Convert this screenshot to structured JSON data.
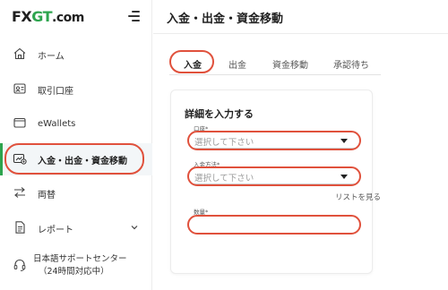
{
  "brand": {
    "logo_fx": "FX",
    "logo_gt": "GT",
    "logo_com": ".com"
  },
  "sidebar": {
    "items": [
      {
        "label": "ホーム",
        "icon": "home-icon"
      },
      {
        "label": "取引口座",
        "icon": "trading-account-icon"
      },
      {
        "label": "eWallets",
        "icon": "wallet-icon"
      },
      {
        "label": "入金・出金・資金移動",
        "icon": "funds-icon"
      },
      {
        "label": "両替",
        "icon": "exchange-icon"
      },
      {
        "label": "レポート",
        "icon": "report-icon"
      }
    ],
    "support_line1": "日本語サポートセンター",
    "support_line2": "（24時間対応中）"
  },
  "main": {
    "title": "入金・出金・資金移動",
    "tabs": [
      {
        "label": "入金"
      },
      {
        "label": "出金"
      },
      {
        "label": "資金移動"
      },
      {
        "label": "承認待ち"
      }
    ],
    "form": {
      "title": "詳細を入力する",
      "account_label": "口座*",
      "account_placeholder": "選択して下さい",
      "method_label": "入金方法*",
      "method_placeholder": "選択して下さい",
      "list_link": "リストを見る",
      "amount_label": "数量*",
      "amount_value": ""
    }
  },
  "colors": {
    "accent": "#2da44e",
    "annotation": "#e0513c",
    "active_bg": "#f3f6f8"
  }
}
